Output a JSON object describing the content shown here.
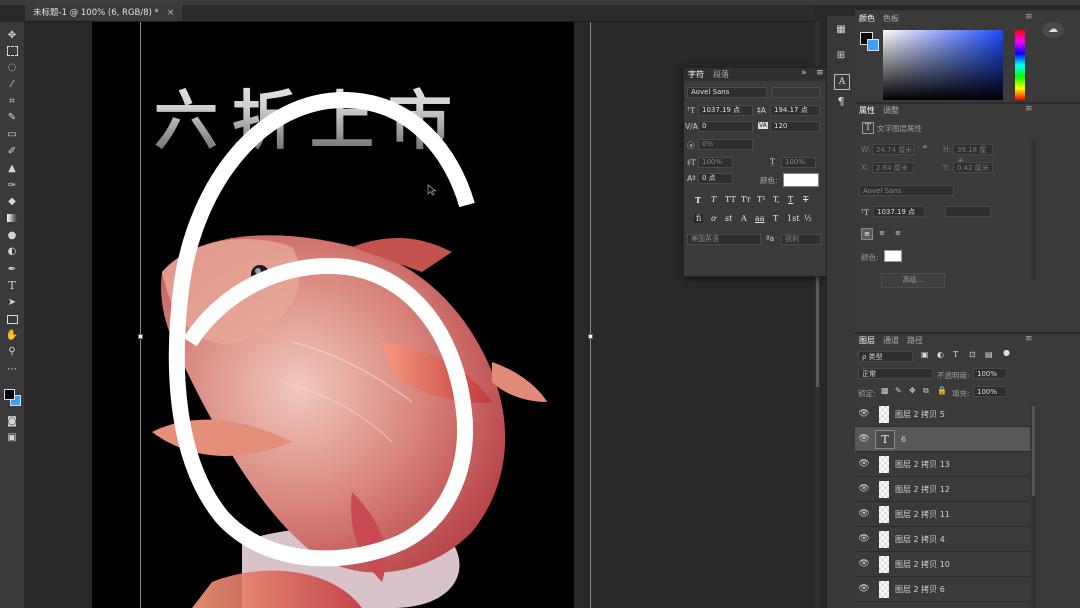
{
  "document": {
    "tab_title": "未标题-1 @ 100% (6, RGB/8) *",
    "close_glyph": "×"
  },
  "canvas": {
    "headline": "六折上市",
    "big_numeral": "6"
  },
  "toolbar": {
    "icons": [
      "move-icon",
      "marquee-icon",
      "lasso-icon",
      "magic-wand-icon",
      "crop-icon",
      "eyedropper-icon",
      "healing-brush-icon",
      "brush-icon",
      "clone-stamp-icon",
      "history-brush-icon",
      "eraser-icon",
      "gradient-icon",
      "blur-icon",
      "dodge-icon",
      "pen-icon",
      "type-icon",
      "path-selection-icon",
      "rectangle-icon",
      "hand-icon",
      "zoom-icon",
      "more-tools-icon",
      "foreground-background-icon",
      "quick-mask-icon",
      "screen-mode-icon"
    ]
  },
  "color_panel": {
    "tabs": [
      "颜色",
      "色板"
    ]
  },
  "properties_panel": {
    "tabs": [
      "属性",
      "调整"
    ],
    "layer_kind": "文字图层属性",
    "w_label": "W:",
    "w_value": "24.74 厘米",
    "h_label": "H:",
    "h_value": "39.18 厘米",
    "x_label": "X:",
    "x_value": "2.64 厘米",
    "y_label": "Y:",
    "y_value": "0.42 厘米",
    "font": "Aovel Sans",
    "size": "1037.19 点",
    "color_label": "颜色:",
    "advanced_button": "高级..."
  },
  "character_panel": {
    "tabs": [
      "字符",
      "段落"
    ],
    "font_family": "Aovel Sans",
    "font_size": "1037.19 点",
    "leading": "194.17 点",
    "kerning": "0",
    "tracking": "120",
    "tsume": "0%",
    "vertical_scale": "100%",
    "horizontal_scale": "100%",
    "baseline_shift": "0 点",
    "color_label": "颜色:",
    "style_buttons": [
      "T",
      "T",
      "TT",
      "Tт",
      "T¹",
      "T,",
      "T",
      "T"
    ],
    "opentype_buttons": [
      "ﬁ",
      "ơ",
      "st",
      "A",
      "aa",
      "T",
      "1st",
      "½"
    ],
    "language": "美国英语",
    "antialias_label": "ªa",
    "antialias": "锐利"
  },
  "layers_panel": {
    "tabs": [
      "图层",
      "通道",
      "路径"
    ],
    "filter_kind": "ρ 类型",
    "blend_mode": "正常",
    "opacity_label": "不透明度:",
    "opacity": "100%",
    "lock_label": "锁定:",
    "fill_label": "填充:",
    "fill": "100%",
    "layers": [
      {
        "name": "图层 2 拷贝 5",
        "type": "pixel",
        "selected": false
      },
      {
        "name": "6",
        "type": "text",
        "selected": true
      },
      {
        "name": "图层 2 拷贝 13",
        "type": "pixel",
        "selected": false
      },
      {
        "name": "图层 2 拷贝 12",
        "type": "pixel",
        "selected": false
      },
      {
        "name": "图层 2 拷贝 11",
        "type": "pixel",
        "selected": false
      },
      {
        "name": "图层 2 拷贝 4",
        "type": "pixel",
        "selected": false
      },
      {
        "name": "图层 2 拷贝 10",
        "type": "pixel",
        "selected": false
      },
      {
        "name": "图层 2 拷贝 6",
        "type": "pixel",
        "selected": false
      }
    ]
  }
}
